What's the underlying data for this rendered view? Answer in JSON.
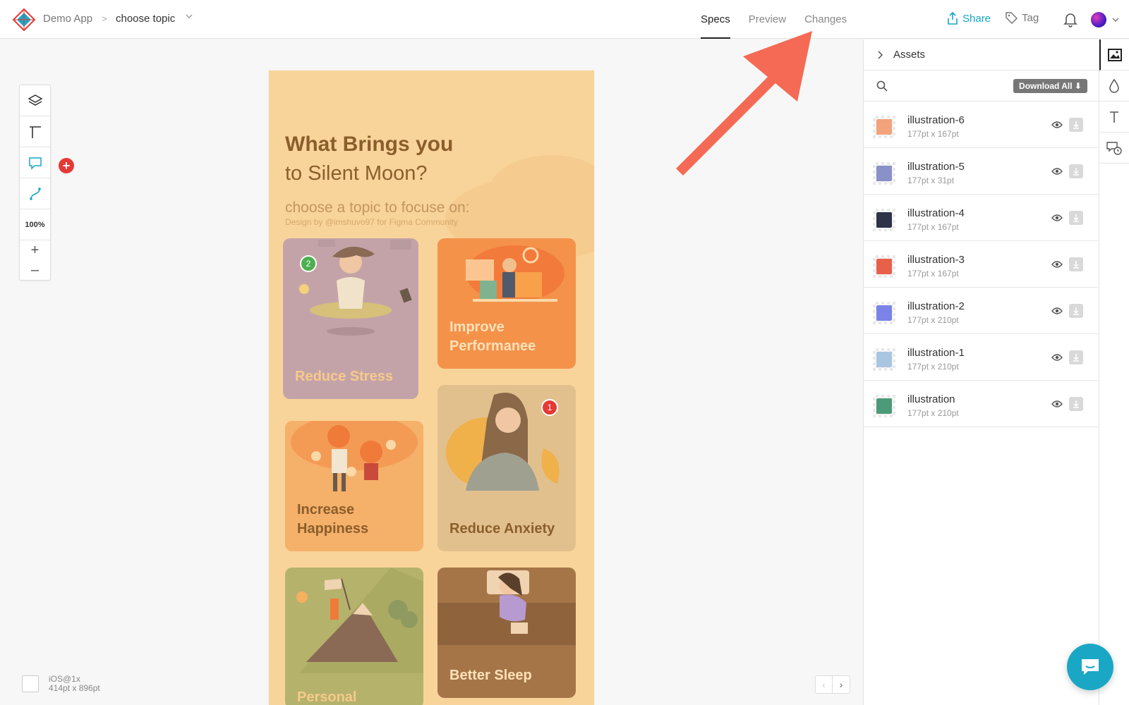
{
  "breadcrumb": {
    "app": "Demo App",
    "separator": ">",
    "page": "choose topic"
  },
  "tabs": [
    {
      "label": "Specs",
      "active": true
    },
    {
      "label": "Preview",
      "active": false
    },
    {
      "label": "Changes",
      "active": false
    }
  ],
  "header": {
    "share": "Share",
    "tag": "Tag"
  },
  "toolbar": {
    "zoom": "100%",
    "zoom_in": "+",
    "zoom_out": "–",
    "add": "+"
  },
  "artboard": {
    "title_line1": "What Brings you",
    "title_line2": "to Silent Moon?",
    "subtitle": "choose a topic to focuse on:",
    "credit": "Design by @imshuvo97 for Figma Community",
    "cards": [
      {
        "label": "Reduce Stress",
        "bg": "#c4a3a8",
        "color": "#f7c98a",
        "badge": "2",
        "badge_color": "#4caf50"
      },
      {
        "label": "Improve Performanee",
        "bg": "#f4924a",
        "color": "#fde1b8"
      },
      {
        "label": "Increase Happiness",
        "bg": "#f5b06a",
        "color": "#8a5e2c"
      },
      {
        "label": "Reduce Anxiety",
        "bg": "#e2c08d",
        "color": "#8a5e2c",
        "badge": "1",
        "badge_color": "#e53935"
      },
      {
        "label": "Personal",
        "bg": "#b5b26c",
        "color": "#f7c98a"
      },
      {
        "label": "Better Sleep",
        "bg": "#a57548",
        "color": "#fde1b8"
      }
    ]
  },
  "artboard_info": {
    "platform": "iOS@1x",
    "size": "414pt x 896pt"
  },
  "pager": {
    "prev": "‹",
    "next": "›"
  },
  "assets_panel": {
    "title": "Assets",
    "download_all": "Download All ⬇",
    "items": [
      {
        "name": "illustration-6",
        "size": "177pt x 167pt",
        "color": "#f2a37a"
      },
      {
        "name": "illustration-5",
        "size": "177pt x 31pt",
        "color": "#8a90c8"
      },
      {
        "name": "illustration-4",
        "size": "177pt x 167pt",
        "color": "#2e3348"
      },
      {
        "name": "illustration-3",
        "size": "177pt x 167pt",
        "color": "#e8604a"
      },
      {
        "name": "illustration-2",
        "size": "177pt x 210pt",
        "color": "#7b83e8"
      },
      {
        "name": "illustration-1",
        "size": "177pt x 210pt",
        "color": "#a9c6e0"
      },
      {
        "name": "illustration",
        "size": "177pt x 210pt",
        "color": "#4d9a7a"
      }
    ]
  },
  "colors": {
    "accent": "#17a6c4",
    "arrow": "#f46a55"
  }
}
